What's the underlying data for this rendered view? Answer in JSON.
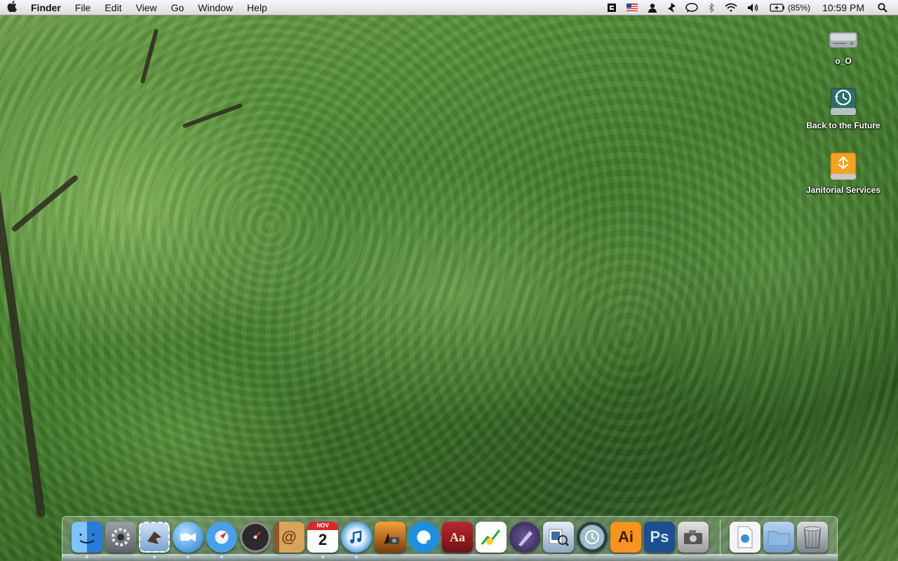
{
  "menubar": {
    "apple_icon": "apple-icon",
    "app_name": "Finder",
    "items": [
      "File",
      "Edit",
      "View",
      "Go",
      "Window",
      "Help"
    ],
    "status": {
      "battery_percent": "(85%)",
      "clock": "10:59 PM"
    }
  },
  "desktop": {
    "icons": [
      {
        "label": "o_O",
        "icon": "hard-drive-icon"
      },
      {
        "label": "Back to the Future",
        "icon": "time-machine-drive-icon"
      },
      {
        "label": "Janitorial Services",
        "icon": "external-drive-icon"
      }
    ]
  },
  "dock": {
    "apps": [
      "finder-icon",
      "system-preferences-icon",
      "mail-icon",
      "ichat-icon",
      "safari-icon",
      "dashboard-icon",
      "address-book-icon",
      "ical-icon",
      "itunes-icon",
      "iphoto-icon",
      "quicktime-icon",
      "dictionary-icon",
      "stocks-icon",
      "pen-app-icon",
      "preview-icon",
      "time-machine-icon",
      "illustrator-icon",
      "photoshop-icon",
      "image-capture-icon"
    ],
    "ical_month": "NOV",
    "ical_day": "2",
    "illustrator_label": "Ai",
    "photoshop_label": "Ps",
    "dictionary_label": "Aa",
    "right_items": [
      "document-icon",
      "folder-icon",
      "trash-icon"
    ]
  },
  "colors": {
    "menubar": "#e6e6e6",
    "wallpaper_green": "#4f8a34",
    "running_dot": "#bfe8ff"
  }
}
